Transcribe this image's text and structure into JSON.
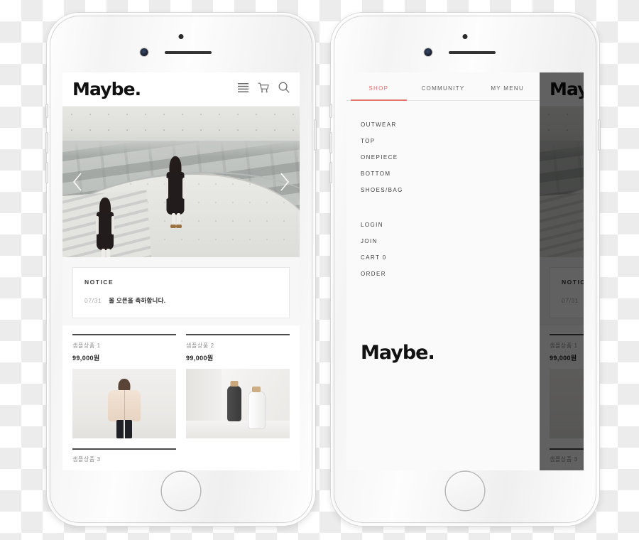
{
  "storefront": {
    "brand": "Maybe.",
    "header_icons": [
      {
        "name": "hamburger-menu-icon",
        "label": "menu"
      },
      {
        "name": "shopping-cart-icon",
        "label": "cart"
      },
      {
        "name": "search-icon",
        "label": "search"
      }
    ],
    "carousel": {
      "prev_label": "‹",
      "next_label": "›"
    },
    "notice": {
      "title": "NOTICE",
      "date": "07/31",
      "text": "몰 오픈을 축하합니다."
    },
    "products": [
      {
        "name": "샘플상품 1",
        "price": "99,000원"
      },
      {
        "name": "샘플상품 2",
        "price": "99,000원"
      }
    ],
    "next_row_product": {
      "name": "샘플상품 3"
    }
  },
  "menu_drawer": {
    "tabs": [
      {
        "label": "SHOP",
        "active": true
      },
      {
        "label": "COMMUNITY",
        "active": false
      },
      {
        "label": "MY MENU",
        "active": false
      }
    ],
    "categories": [
      {
        "label": "OUTWEAR"
      },
      {
        "label": "TOP"
      },
      {
        "label": "ONEPIECE"
      },
      {
        "label": "BOTTOM"
      },
      {
        "label": "SHOES/BAG"
      }
    ],
    "account": [
      {
        "label": "LOGIN"
      },
      {
        "label": "JOIN"
      },
      {
        "label": "CART 0"
      },
      {
        "label": "ORDER"
      }
    ],
    "brand": "Maybe."
  },
  "colors": {
    "accent": "#e2736d",
    "text_dark": "#111111",
    "text_muted": "#8e8e8e",
    "rule": "#4a4a4a",
    "panel_bg": "#fafafa",
    "scrim": "rgba(0,0,0,0.62)"
  }
}
